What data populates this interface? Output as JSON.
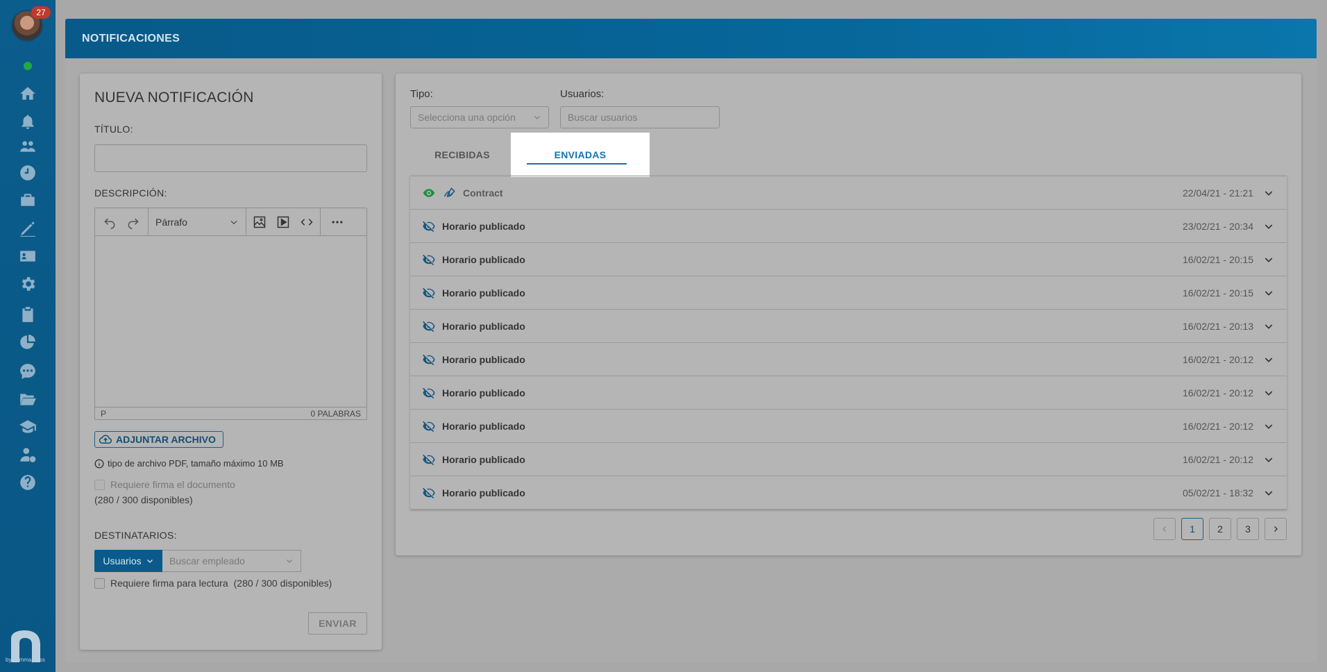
{
  "sidebar": {
    "badge_count": "27",
    "brand_text": "by nommapress"
  },
  "header": {
    "title": "NOTIFICACIONES"
  },
  "new_notification": {
    "title": "NUEVA NOTIFICACIÓN",
    "title_label": "TÍTULO:",
    "title_value": "",
    "description_label": "DESCRIPCIÓN:",
    "format_select": "Párrafo",
    "status_path": "P",
    "word_count": "0 PALABRAS",
    "attach_label": "ADJUNTAR ARCHIVO",
    "attach_info": "tipo de archivo PDF, tamaño máximo 10 MB",
    "require_sign_doc": "Requiere firma el documento",
    "available_1": "(280 / 300 disponibles)",
    "recipients_label": "DESTINATARIOS:",
    "recipients_type": "Usuarios",
    "employee_placeholder": "Buscar empleado",
    "require_sign_read": "Requiere firma para lectura",
    "available_2": "(280 / 300 disponibles)",
    "send_label": "ENVIAR"
  },
  "filters": {
    "type_label": "Tipo:",
    "type_placeholder": "Selecciona una opción",
    "users_label": "Usuarios:",
    "users_placeholder": "Buscar usuarios"
  },
  "tabs": {
    "received": "RECIBIDAS",
    "sent": "ENVIADAS"
  },
  "notifications": [
    {
      "title": "Contract",
      "date": "22/04/21 - 21:21",
      "seen": true
    },
    {
      "title": "Horario publicado",
      "date": "23/02/21 - 20:34",
      "seen": false
    },
    {
      "title": "Horario publicado",
      "date": "16/02/21 - 20:15",
      "seen": false
    },
    {
      "title": "Horario publicado",
      "date": "16/02/21 - 20:15",
      "seen": false
    },
    {
      "title": "Horario publicado",
      "date": "16/02/21 - 20:13",
      "seen": false
    },
    {
      "title": "Horario publicado",
      "date": "16/02/21 - 20:12",
      "seen": false
    },
    {
      "title": "Horario publicado",
      "date": "16/02/21 - 20:12",
      "seen": false
    },
    {
      "title": "Horario publicado",
      "date": "16/02/21 - 20:12",
      "seen": false
    },
    {
      "title": "Horario publicado",
      "date": "16/02/21 - 20:12",
      "seen": false
    },
    {
      "title": "Horario publicado",
      "date": "05/02/21 - 18:32",
      "seen": false
    }
  ],
  "pagination": {
    "pages": [
      "1",
      "2",
      "3"
    ],
    "current": "1"
  },
  "colors": {
    "accent": "#1373b0",
    "sidebar": "#0b5d8c",
    "online": "#22a845",
    "badge": "#c0392b"
  }
}
